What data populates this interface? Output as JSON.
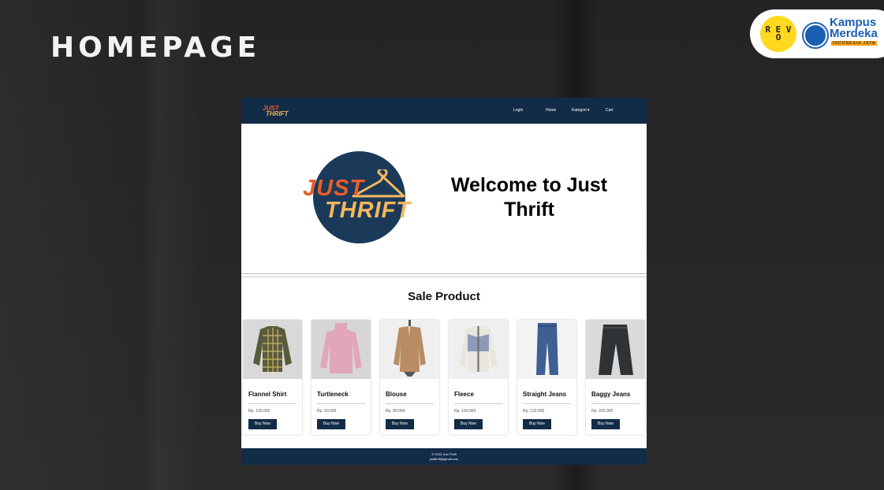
{
  "slide": {
    "title": "HOMEPAGE"
  },
  "logos": {
    "revo": "R E V O",
    "kampus_merdeka": "Kampus Merdeka",
    "km_sub": "INDONESIA JAYA"
  },
  "site": {
    "nav": {
      "brand_line1": "JUST",
      "brand_line2": "THRIFT",
      "items": [
        "Login",
        "Home",
        "Kategori ▾",
        "Cart"
      ]
    },
    "hero": {
      "logo_line1": "JUST",
      "logo_line2": "THRIFT",
      "welcome": "Welcome to Just Thrift"
    },
    "sale_title": "Sale Product",
    "products": [
      {
        "name": "Flannel Shirt",
        "price": "Rp. 100.000",
        "button": "Buy Now",
        "icon": "flannel-shirt"
      },
      {
        "name": "Turtleneck",
        "price": "Rp. 50.000",
        "button": "Buy Now",
        "icon": "turtleneck"
      },
      {
        "name": "Blouse",
        "price": "Rp. 80.000",
        "button": "Buy Now",
        "icon": "blouse"
      },
      {
        "name": "Fleece",
        "price": "Rp. 150.000",
        "button": "Buy Now",
        "icon": "fleece-jacket"
      },
      {
        "name": "Straight Jeans",
        "price": "Rp. 120.000",
        "button": "Buy Now",
        "icon": "straight-jeans"
      },
      {
        "name": "Baggy Jeans",
        "price": "Rp. 200.000",
        "button": "Buy Now",
        "icon": "baggy-jeans"
      }
    ],
    "footer": {
      "copyright": "© 2023 Just Thrift",
      "email": "justthrift@gmail.com"
    }
  },
  "colors": {
    "nav_bg": "#122c47",
    "brand_orange": "#e85d2a",
    "brand_yellow": "#f5b85a"
  }
}
